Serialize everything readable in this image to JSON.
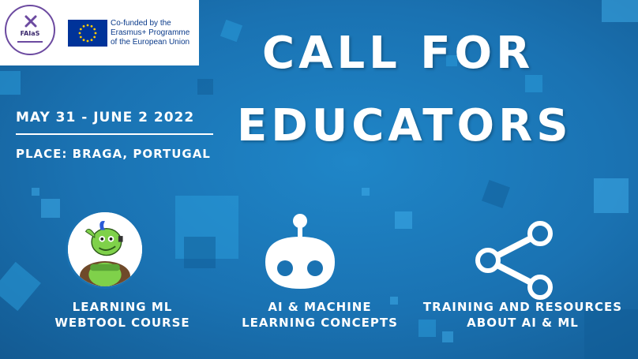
{
  "logos": {
    "faias_name": "FAIaS",
    "eu_lines": [
      "Co-funded by the",
      "Erasmus+ Programme",
      "of the European Union"
    ]
  },
  "title": {
    "line1": "CALL FOR",
    "line2": "EDUCATORS"
  },
  "event": {
    "date": "MAY 31 - JUNE 2 2022",
    "place": "PLACE: BRAGA, PORTUGAL"
  },
  "features": [
    {
      "icon": "mascot-icon",
      "line1": "LEARNING ML",
      "line2": "WEBTOOL COURSE"
    },
    {
      "icon": "robot-icon",
      "line1": "AI & MACHINE",
      "line2": "LEARNING CONCEPTS"
    },
    {
      "icon": "share-icon",
      "line1": "TRAINING AND RESOURCES",
      "line2": "ABOUT AI & ML"
    }
  ],
  "colors": {
    "background": "#1a72b2",
    "text": "#ffffff",
    "eu_blue": "#003399",
    "eu_star": "#ffcc00",
    "mascot_green": "#7fd14a"
  }
}
